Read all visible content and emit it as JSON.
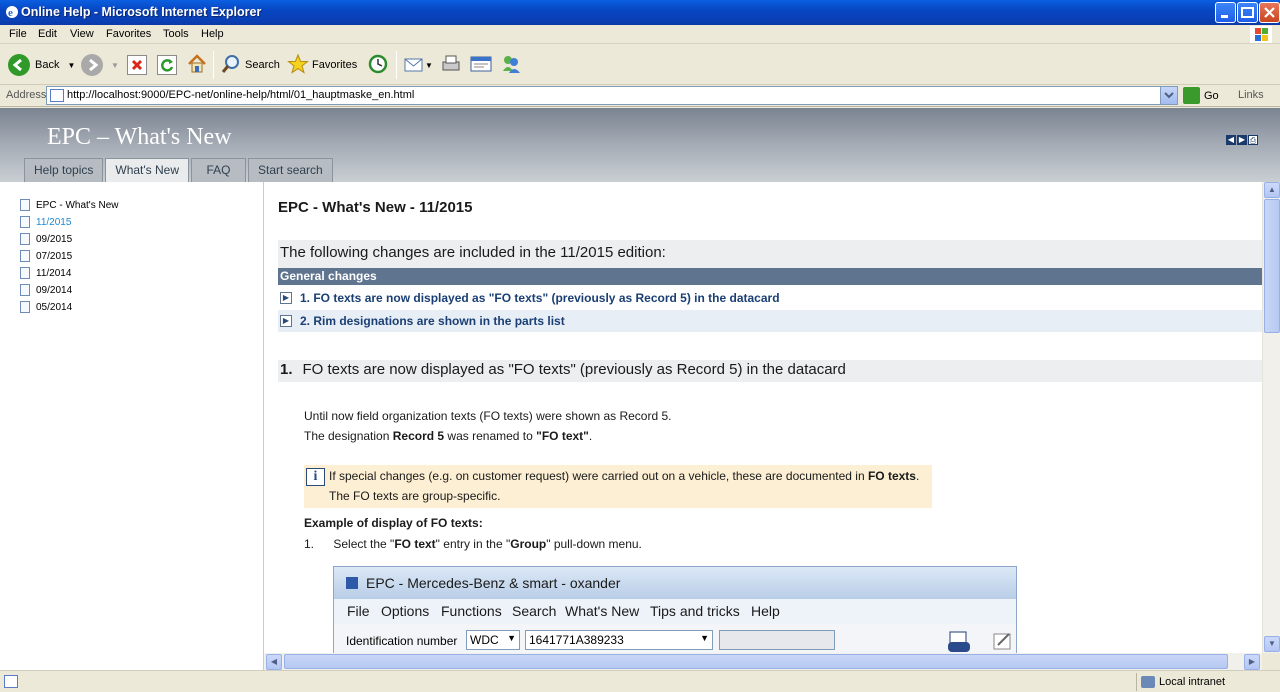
{
  "window": {
    "title": "Online Help - Microsoft Internet Explorer"
  },
  "menu": [
    "File",
    "Edit",
    "View",
    "Favorites",
    "Tools",
    "Help"
  ],
  "toolbar": {
    "back": "Back",
    "search": "Search",
    "favorites": "Favorites"
  },
  "address": {
    "label": "Address",
    "url": "http://localhost:9000/EPC-net/online-help/html/01_hauptmaske_en.html",
    "go": "Go",
    "links": "Links"
  },
  "header": {
    "title": "EPC – What's New",
    "tabs": [
      "Help topics",
      "What's New",
      "FAQ",
      "Start search"
    ]
  },
  "sidebar": {
    "items": [
      "EPC - What's New",
      "11/2015",
      "09/2015",
      "07/2015",
      "11/2014",
      "09/2014",
      "05/2014"
    ]
  },
  "main": {
    "title": "EPC - What's New - 11/2015",
    "subtitle": "The following changes are included in the 11/2015 edition:",
    "general_changes": "General changes",
    "links": [
      "1. FO texts are now displayed as \"FO texts\" (previously as Record 5) in the datacard",
      "2. Rim designations are shown in the parts list"
    ],
    "section": {
      "num": "1.",
      "title": "FO texts are now displayed as \"FO texts\" (previously as Record 5) in the datacard"
    },
    "para1": "Until now field organization texts (FO texts) were shown as Record 5.",
    "para2_pre": "The designation ",
    "para2_b1": "Record 5",
    "para2_mid": " was renamed to ",
    "para2_b2": "\"FO text\"",
    "para2_end": ".",
    "note_pre": "If special changes (e.g. on customer request) were carried out on a vehicle, these are documented in ",
    "note_b": "FO texts",
    "note_end": ".",
    "note_line2": "The FO texts are group-specific.",
    "example_heading": "Example of display of FO texts:",
    "step_num": "1.",
    "step_pre": "Select the \"",
    "step_b1": "FO text",
    "step_mid": "\" entry in the \"",
    "step_b2": "Group",
    "step_end": "\" pull-down menu."
  },
  "embedded": {
    "title": "EPC - Mercedes-Benz & smart - oxander",
    "menu": [
      "File",
      "Options",
      "Functions",
      "Search",
      "What's New",
      "Tips and tricks",
      "Help"
    ],
    "id_label": "Identification number",
    "wmi": "WDC",
    "vin": "1641771A389233"
  },
  "status": {
    "zone": "Local intranet"
  }
}
